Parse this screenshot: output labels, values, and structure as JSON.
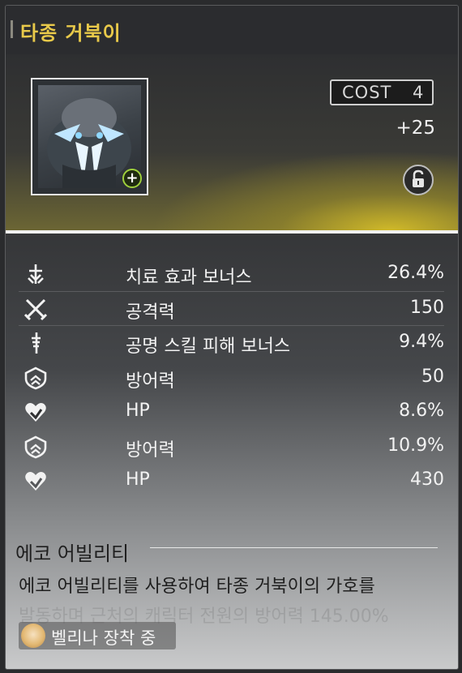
{
  "echo": {
    "name": "타종 거북이",
    "cost_label": "COST",
    "cost_value": "4",
    "level_bonus": "+25"
  },
  "stats": [
    {
      "icon": "healing-bonus-icon",
      "name": "치료 효과 보너스",
      "value": "26.4%"
    },
    {
      "icon": "attack-icon",
      "name": "공격력",
      "value": "150"
    },
    {
      "icon": "resonance-skill-icon",
      "name": "공명 스킬 피해 보너스",
      "value": "9.4%"
    },
    {
      "icon": "defense-icon",
      "name": "방어력",
      "value": "50"
    },
    {
      "icon": "hp-icon",
      "name": "HP",
      "value": "8.6%"
    },
    {
      "icon": "defense-icon",
      "name": "방어력",
      "value": "10.9%"
    },
    {
      "icon": "hp-icon",
      "name": "HP",
      "value": "430"
    }
  ],
  "ability": {
    "title": "에코 어빌리티",
    "description": "에코 어빌리티를 사용하여 타종 거북이의 가호를",
    "description_faded": "발동하며 근처의 캐릭터 전원의 방어력 145.00%"
  },
  "equipped": {
    "label": "벨리나 장착 중"
  },
  "colors": {
    "title": "#e8c94a",
    "accent_yellow": "#d6be28",
    "plus_badge": "#9fd03c"
  }
}
